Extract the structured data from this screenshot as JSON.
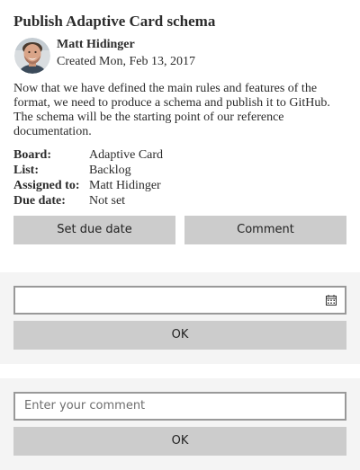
{
  "card": {
    "title": "Publish Adaptive Card schema",
    "author": {
      "name": "Matt Hidinger",
      "created": "Created Mon, Feb 13, 2017"
    },
    "description": "Now that we have defined the main rules and features of the format, we need to produce a schema and publish it to GitHub. The schema will be the starting point of our reference documentation.",
    "facts": [
      {
        "title": "Board:",
        "value": "Adaptive Card"
      },
      {
        "title": "List:",
        "value": "Backlog"
      },
      {
        "title": "Assigned to:",
        "value": "Matt Hidinger"
      },
      {
        "title": "Due date:",
        "value": "Not set"
      }
    ],
    "actions": {
      "set_due_date_label": "Set due date",
      "comment_label": "Comment"
    }
  },
  "due_date_panel": {
    "date_value": "",
    "ok_label": "OK"
  },
  "comment_panel": {
    "placeholder": "Enter your comment",
    "value": "",
    "ok_label": "OK"
  },
  "icons": {
    "calendar": "calendar-icon",
    "avatar": "avatar"
  },
  "colors": {
    "button_bg": "#cccccc",
    "panel_bg": "#f4f4f4",
    "input_border": "#999999",
    "text": "#2b2b2b"
  }
}
